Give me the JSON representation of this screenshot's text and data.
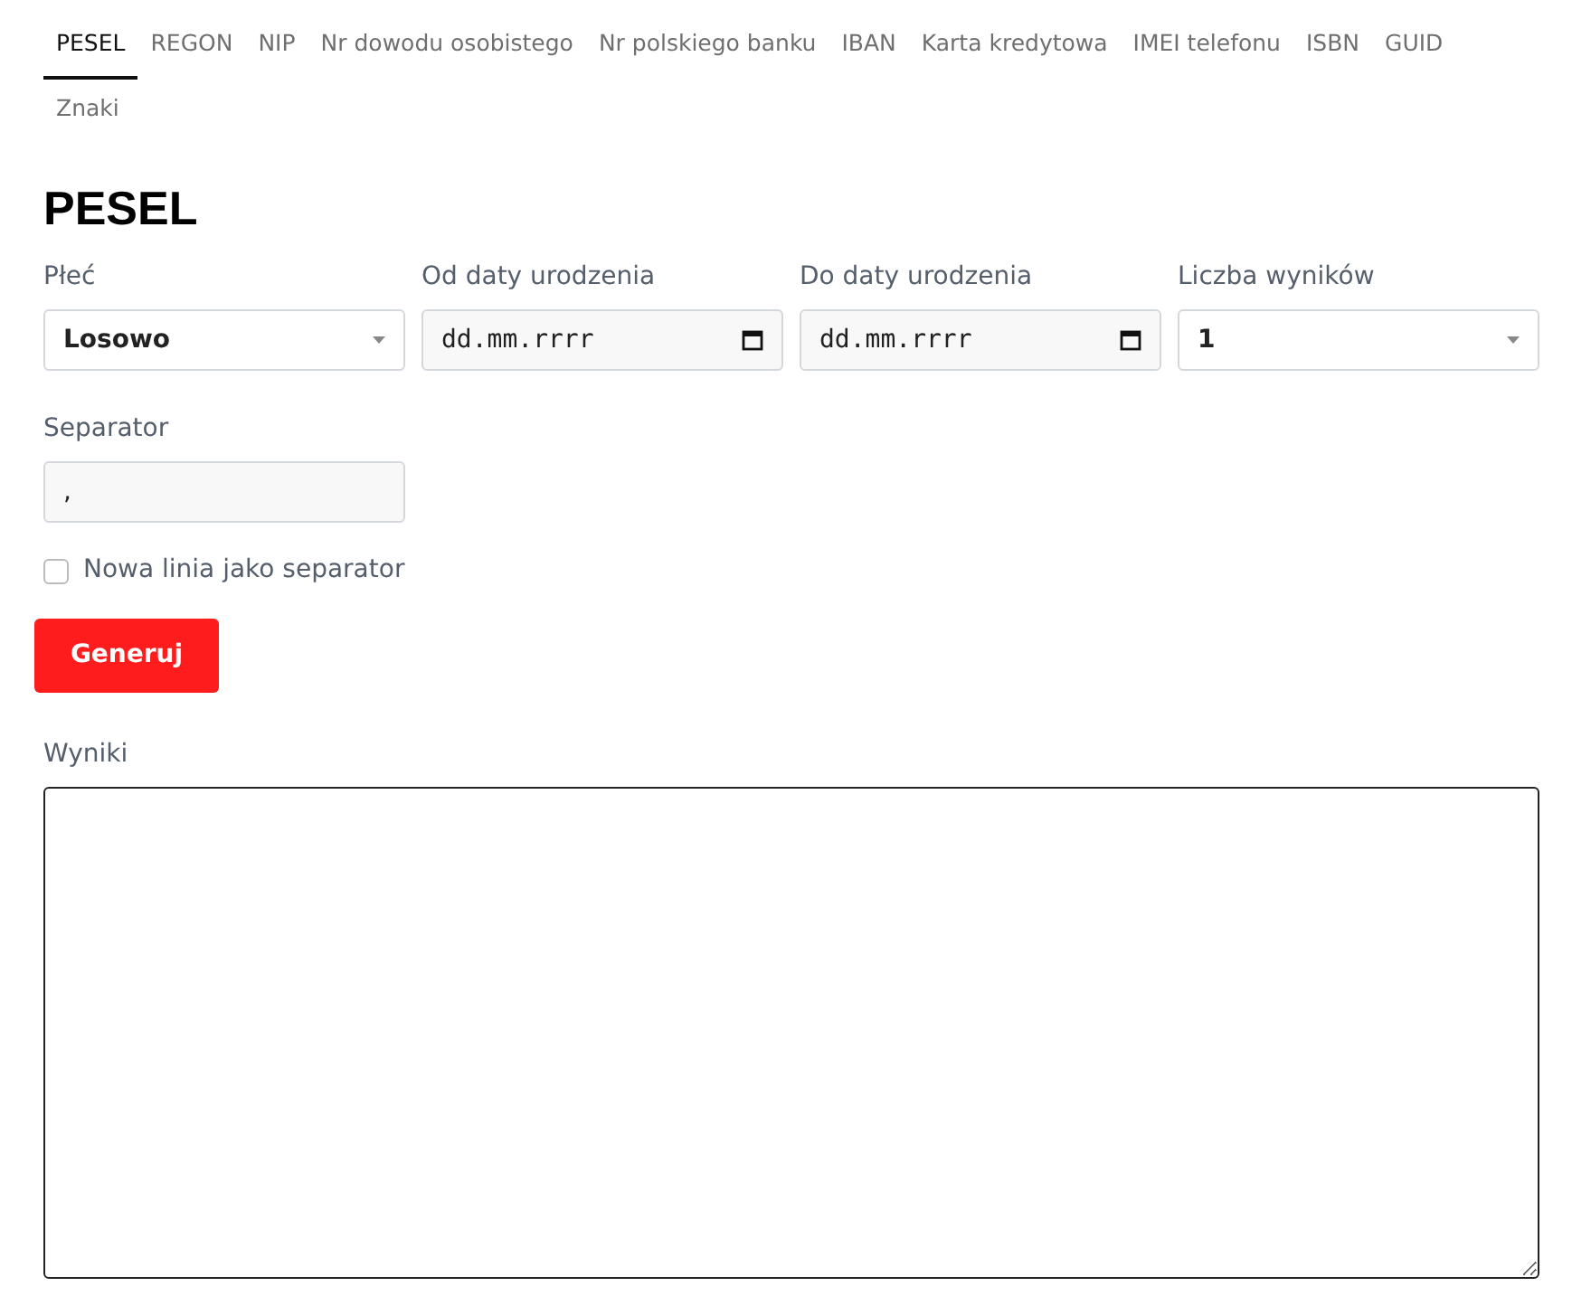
{
  "tabs": [
    {
      "label": "PESEL",
      "selected": true
    },
    {
      "label": "REGON",
      "selected": false
    },
    {
      "label": "NIP",
      "selected": false
    },
    {
      "label": "Nr dowodu osobistego",
      "selected": false
    },
    {
      "label": "Nr polskiego banku",
      "selected": false
    },
    {
      "label": "IBAN",
      "selected": false
    },
    {
      "label": "Karta kredytowa",
      "selected": false
    },
    {
      "label": "IMEI telefonu",
      "selected": false
    },
    {
      "label": "ISBN",
      "selected": false
    },
    {
      "label": "GUID",
      "selected": false
    },
    {
      "label": "Znaki",
      "selected": false
    }
  ],
  "heading": "PESEL",
  "fields": [
    {
      "kind": "select",
      "label": "Płeć",
      "value": "Losowo"
    },
    {
      "kind": "date",
      "label": "Od daty urodzenia",
      "placeholder": "dd.mm.rrrr"
    },
    {
      "kind": "date",
      "label": "Do daty urodzenia",
      "placeholder": "dd.mm.rrrr"
    },
    {
      "kind": "select",
      "label": "Liczba wyników",
      "value": "1"
    },
    {
      "kind": "text",
      "label": "Separator",
      "value": ","
    }
  ],
  "checkbox": {
    "label": "Nowa linia jako separator",
    "checked": false
  },
  "button": "Generuj",
  "results": {
    "label": "Wyniki"
  }
}
